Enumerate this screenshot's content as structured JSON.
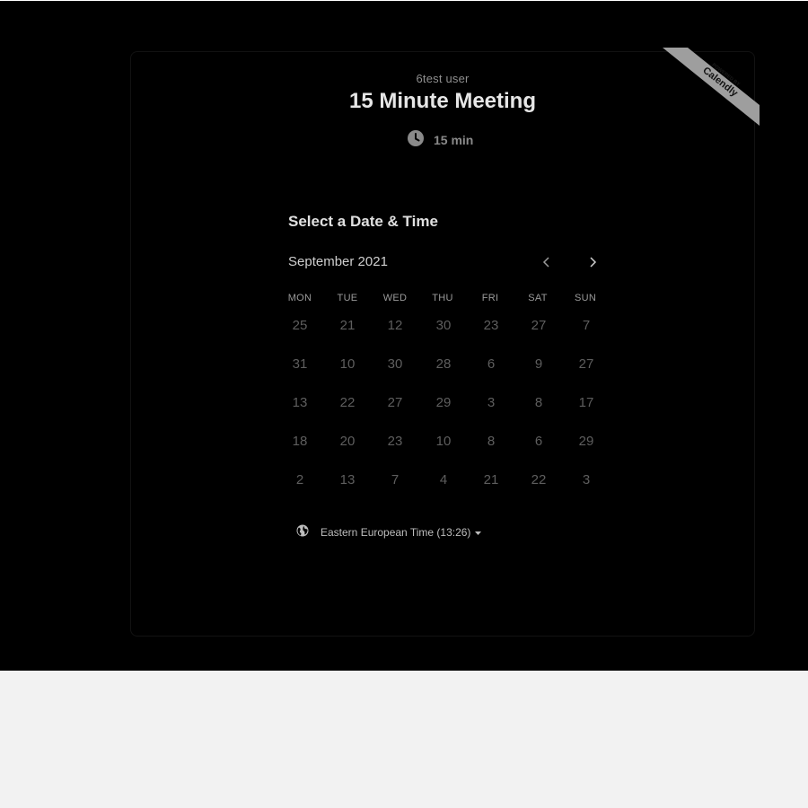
{
  "owner_name": "6test user",
  "event_title": "15 Minute Meeting",
  "duration": "15 min",
  "section_title": "Select a Date & Time",
  "calendar": {
    "month_label": "September 2021",
    "weekdays": [
      "MON",
      "TUE",
      "WED",
      "THU",
      "FRI",
      "SAT",
      "SUN"
    ],
    "weeks": [
      [
        "25",
        "21",
        "12",
        "30",
        "23",
        "27",
        "7"
      ],
      [
        "31",
        "10",
        "30",
        "28",
        "6",
        "9",
        "27"
      ],
      [
        "13",
        "22",
        "27",
        "29",
        "3",
        "8",
        "17"
      ],
      [
        "18",
        "20",
        "23",
        "10",
        "8",
        "6",
        "29"
      ],
      [
        "2",
        "13",
        "7",
        "4",
        "21",
        "22",
        "3"
      ]
    ]
  },
  "timezone": "Eastern European Time (13:26)",
  "badge": {
    "line1": "POWERED BY",
    "line2": "Calendly"
  },
  "icons": {
    "duration": "clock-icon",
    "prev": "chevron-left-icon",
    "next": "chevron-right-icon",
    "timezone": "globe-icon",
    "dropdown": "caret-down-icon"
  },
  "colors": {
    "background_overlay": "#000000",
    "page_background": "#f2f2f2",
    "badge_background": "#9e9e9e",
    "title_text": "#e6e6e6",
    "day_text": "#5e5e5e"
  }
}
